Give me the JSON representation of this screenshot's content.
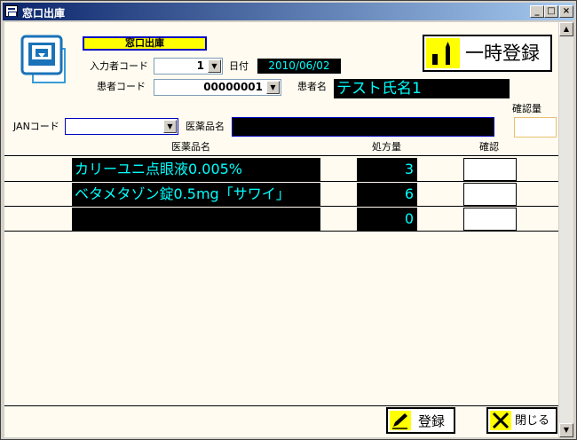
{
  "window": {
    "title": "窓口出庫",
    "min_btn": "_",
    "max_btn": "□",
    "close_btn": "×"
  },
  "form": {
    "heading": "窓口出庫",
    "input_user_label": "入力者コード",
    "input_user_value": "1",
    "date_label": "日付",
    "date_value": "2010/06/02",
    "patient_code_label": "患者コード",
    "patient_code_value": "00000001",
    "patient_name_label": "患者名",
    "patient_name_value": "テスト氏名1",
    "temp_save_label": "一時登録",
    "confirm_qty_label": "確認量",
    "jan_label": "JANコード",
    "jan_value": "",
    "drug_name_label": "医薬品名",
    "drug_name_value": ""
  },
  "table": {
    "headers": {
      "drug_name": "医薬品名",
      "qty": "処方量",
      "confirm": "確認"
    },
    "rows": [
      {
        "drug_name": "カリーユニ点眼液0.005%",
        "qty": "3"
      },
      {
        "drug_name": "ベタメタゾン錠0.5mg「サワイ」",
        "qty": "6"
      },
      {
        "drug_name": "",
        "qty": "0"
      }
    ]
  },
  "footer": {
    "register_label": "登録",
    "close_label": "閉じる"
  },
  "colors": {
    "accent_cyan": "#00ffff",
    "heading_yellow": "#ffff00",
    "background_cream": "#fffbf0"
  }
}
